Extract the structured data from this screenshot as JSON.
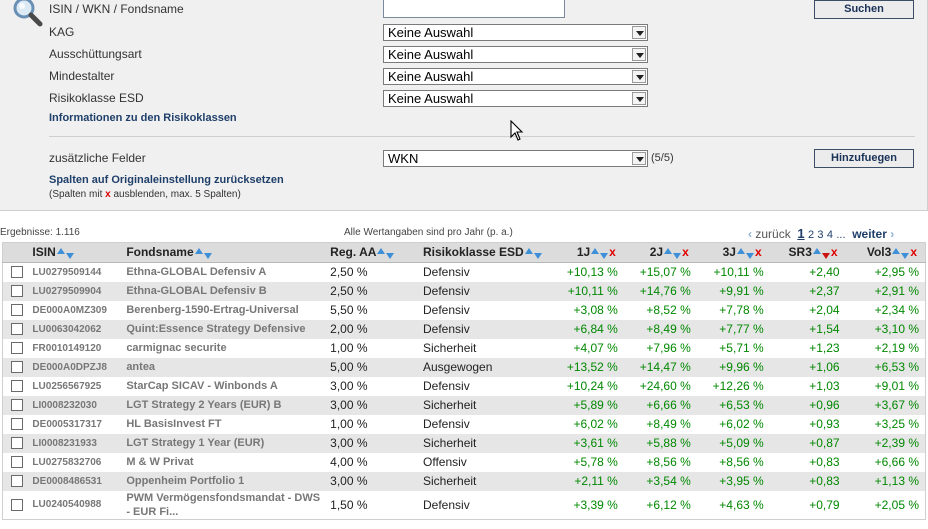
{
  "filters": {
    "search_label": "ISIN / WKN / Fondsname",
    "search_value": "",
    "search_button": "Suchen",
    "kag_label": "KAG",
    "kag_value": "Keine Auswahl",
    "ausschuettung_label": "Ausschüttungsart",
    "ausschuettung_value": "Keine Auswahl",
    "mindestalter_label": "Mindestalter",
    "mindestalter_value": "Keine Auswahl",
    "risiko_label": "Risikoklasse ESD",
    "risiko_value": "Keine Auswahl",
    "risiko_info_link": "Informationen zu den Risikoklassen",
    "extra_fields_label": "zusätzliche Felder",
    "extra_fields_value": "WKN",
    "extra_fields_count": "(5/5)",
    "add_button": "Hinzufuegen",
    "reset_link": "Spalten auf Originaleinstellung zurücksetzen",
    "note_prefix": "(Spalten mit",
    "note_x": "x",
    "note_suffix": "ausblenden, max. 5 Spalten)"
  },
  "results_meta": {
    "count": "Ergebnisse: 1.116",
    "note": "Alle Wertangaben sind pro Jahr (p. a.)",
    "prev": "zurück",
    "current_page": "1",
    "pages": [
      "2",
      "3",
      "4"
    ],
    "ellipsis": "...",
    "next": "weiter"
  },
  "columns": {
    "isin": "ISIN",
    "name": "Fondsname",
    "aa": "Reg. AA",
    "risk": "Risikoklasse ESD",
    "y1": "1J",
    "y2": "2J",
    "y3": "3J",
    "sr3": "SR3",
    "vol3": "Vol3"
  },
  "rows": [
    {
      "isin": "LU0279509144",
      "name": "Ethna-GLOBAL Defensiv A",
      "aa": "2,50 %",
      "risk": "Defensiv",
      "y1": "+10,13 %",
      "y2": "+15,07 %",
      "y3": "+10,11 %",
      "sr3": "+2,40",
      "vol3": "+2,95 %"
    },
    {
      "isin": "LU0279509904",
      "name": "Ethna-GLOBAL Defensiv B",
      "aa": "2,50 %",
      "risk": "Defensiv",
      "y1": "+10,11 %",
      "y2": "+14,76 %",
      "y3": "+9,91 %",
      "sr3": "+2,37",
      "vol3": "+2,91 %"
    },
    {
      "isin": "DE000A0MZ309",
      "name": "Berenberg-1590-Ertrag-Universal",
      "aa": "5,50 %",
      "risk": "Defensiv",
      "y1": "+3,08 %",
      "y2": "+8,52 %",
      "y3": "+7,78 %",
      "sr3": "+2,04",
      "vol3": "+2,34 %"
    },
    {
      "isin": "LU0063042062",
      "name": "Quint:Essence Strategy Defensive",
      "aa": "2,00 %",
      "risk": "Defensiv",
      "y1": "+6,84 %",
      "y2": "+8,49 %",
      "y3": "+7,77 %",
      "sr3": "+1,54",
      "vol3": "+3,10 %"
    },
    {
      "isin": "FR0010149120",
      "name": "carmignac securite",
      "aa": "1,00 %",
      "risk": "Sicherheit",
      "y1": "+4,07 %",
      "y2": "+7,96 %",
      "y3": "+5,71 %",
      "sr3": "+1,23",
      "vol3": "+2,19 %"
    },
    {
      "isin": "DE000A0DPZJ8",
      "name": "antea",
      "aa": "5,00 %",
      "risk": "Ausgewogen",
      "y1": "+13,52 %",
      "y2": "+14,47 %",
      "y3": "+9,96 %",
      "sr3": "+1,06",
      "vol3": "+6,53 %"
    },
    {
      "isin": "LU0256567925",
      "name": "StarCap SICAV - Winbonds A",
      "aa": "3,00 %",
      "risk": "Defensiv",
      "y1": "+10,24 %",
      "y2": "+24,60 %",
      "y3": "+12,26 %",
      "sr3": "+1,03",
      "vol3": "+9,01 %"
    },
    {
      "isin": "LI0008232030",
      "name": "LGT Strategy 2 Years (EUR) B",
      "aa": "3,00 %",
      "risk": "Sicherheit",
      "y1": "+5,89 %",
      "y2": "+6,66 %",
      "y3": "+6,53 %",
      "sr3": "+0,96",
      "vol3": "+3,67 %"
    },
    {
      "isin": "DE0005317317",
      "name": "HL BasisInvest FT",
      "aa": "1,00 %",
      "risk": "Defensiv",
      "y1": "+6,02 %",
      "y2": "+8,49 %",
      "y3": "+6,02 %",
      "sr3": "+0,93",
      "vol3": "+3,25 %"
    },
    {
      "isin": "LI0008231933",
      "name": "LGT Strategy 1 Year (EUR)",
      "aa": "3,00 %",
      "risk": "Sicherheit",
      "y1": "+3,61 %",
      "y2": "+5,88 %",
      "y3": "+5,09 %",
      "sr3": "+0,87",
      "vol3": "+2,39 %"
    },
    {
      "isin": "LU0275832706",
      "name": "M & W Privat",
      "aa": "4,00 %",
      "risk": "Offensiv",
      "y1": "+5,78 %",
      "y2": "+8,56 %",
      "y3": "+8,56 %",
      "sr3": "+0,83",
      "vol3": "+6,66 %"
    },
    {
      "isin": "DE0008486531",
      "name": "Oppenheim Portfolio 1",
      "aa": "3,00 %",
      "risk": "Sicherheit",
      "y1": "+2,11 %",
      "y2": "+3,54 %",
      "y3": "+3,95 %",
      "sr3": "+0,83",
      "vol3": "+1,13 %"
    },
    {
      "isin": "LU0240540988",
      "name": "PWM Vermögensfondsmandat - DWS - EUR Fi...",
      "aa": "1,50 %",
      "risk": "Defensiv",
      "y1": "+3,39 %",
      "y2": "+6,12 %",
      "y3": "+4,63 %",
      "sr3": "+0,79",
      "vol3": "+2,05 %"
    }
  ]
}
